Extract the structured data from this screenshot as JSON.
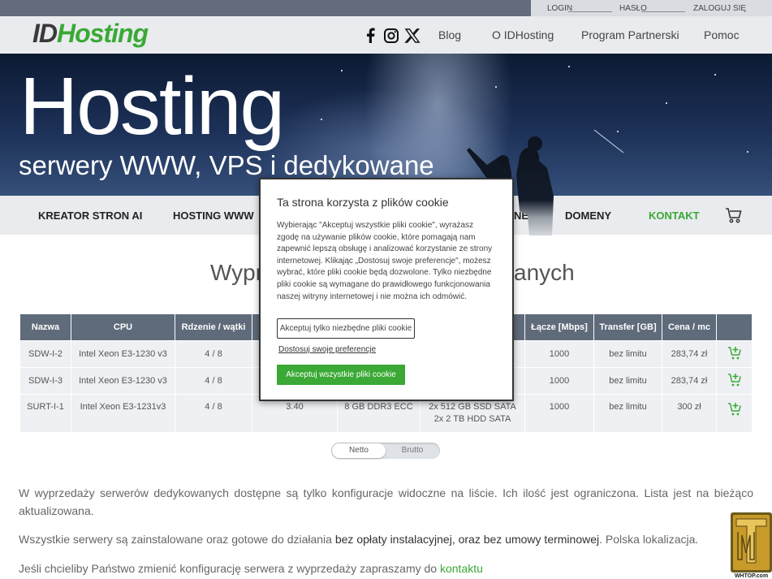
{
  "topbar": {
    "login_label": "LOGIN",
    "password_label": "HASŁO",
    "login_button": "ZALOGUJ SIĘ"
  },
  "header": {
    "logo_id": "ID",
    "logo_hosting": "Hosting",
    "nav": [
      "Blog",
      "O IDHosting",
      "Program Partnerski",
      "Pomoc"
    ]
  },
  "hero": {
    "title": "Hosting",
    "subtitle": "serwery WWW, VPS i dedykowane"
  },
  "main_nav": [
    "KREATOR STRON AI",
    "HOSTING WWW",
    "NE",
    "DOMENY",
    "KONTAKT"
  ],
  "section": {
    "title_start": "Wypr",
    "title_end": "anych"
  },
  "table": {
    "headers": [
      "Nazwa",
      "CPU",
      "Rdzenie / wątki",
      "",
      "",
      "",
      "Łącze [Mbps]",
      "Transfer [GB]",
      "Cena / mc",
      ""
    ],
    "rows": [
      [
        "SDW-I-2",
        "Intel Xeon E3-1230 v3",
        "4 / 8",
        "",
        "",
        "",
        "1000",
        "bez limitu",
        "283,74 zł"
      ],
      [
        "SDW-I-3",
        "Intel Xeon E3-1230 v3",
        "4 / 8",
        "",
        "",
        "",
        "1000",
        "bez limitu",
        "283,74 zł"
      ],
      [
        "SURT-I-1",
        "Intel Xeon E3-1231v3",
        "4 / 8",
        "3.40",
        "8 GB DDR3 ECC",
        "2x 512 GB SSD SATA",
        "1000",
        "bez limitu",
        "300 zł"
      ]
    ],
    "row3_disk_line2": "2x 2 TB HDD SATA"
  },
  "toggle": {
    "on": "Netto",
    "off": "Brutto"
  },
  "paragraphs": {
    "p1": "W wyprzedaży serwerów dedykowanych dostępne są tylko konfiguracje widoczne na liście. Ich ilość jest ograniczona. Lista jest na bieżąco aktualizowana.",
    "p2_a": "Wszystkie serwery są zainstalowane oraz gotowe do działania ",
    "p2_b": "bez opłaty instalacyjnej, oraz bez umowy terminowej",
    "p2_c": ". Polska lokalizacja.",
    "p3_a": "Jeśli chcieliby Państwo zmienić konfigurację serwera z wyprzedaży zapraszamy do ",
    "p3_link": "kontaktu"
  },
  "cookie": {
    "title": "Ta strona korzysta z plików cookie",
    "body": "Wybierając \"Akceptuj wszystkie pliki cookie\", wyrażasz zgodę na używanie plików cookie, które pomagają nam zapewnić lepszą obsługę i analizować korzystanie ze strony internetowej. Klikając „Dostosuj swoje preferencje\", możesz wybrać, które pliki cookie będą dozwolone. Tylko niezbędne pliki cookie są wymagane do prawidłowego funkcjonowania naszej witryny internetowej i nie można ich odmówić.",
    "btn_necessary": "Akceptuj tylko niezbędne pliki cookie",
    "link_prefs": "Dostosuj swoje preferencje",
    "btn_accept": "Akceptuj wszystkie pliki cookie"
  },
  "badge": {
    "text": "WHTOP.com"
  },
  "colors": {
    "brand_green": "#3aa935",
    "table_header": "#5f6b7a",
    "nav_bg": "#e9ebee"
  }
}
